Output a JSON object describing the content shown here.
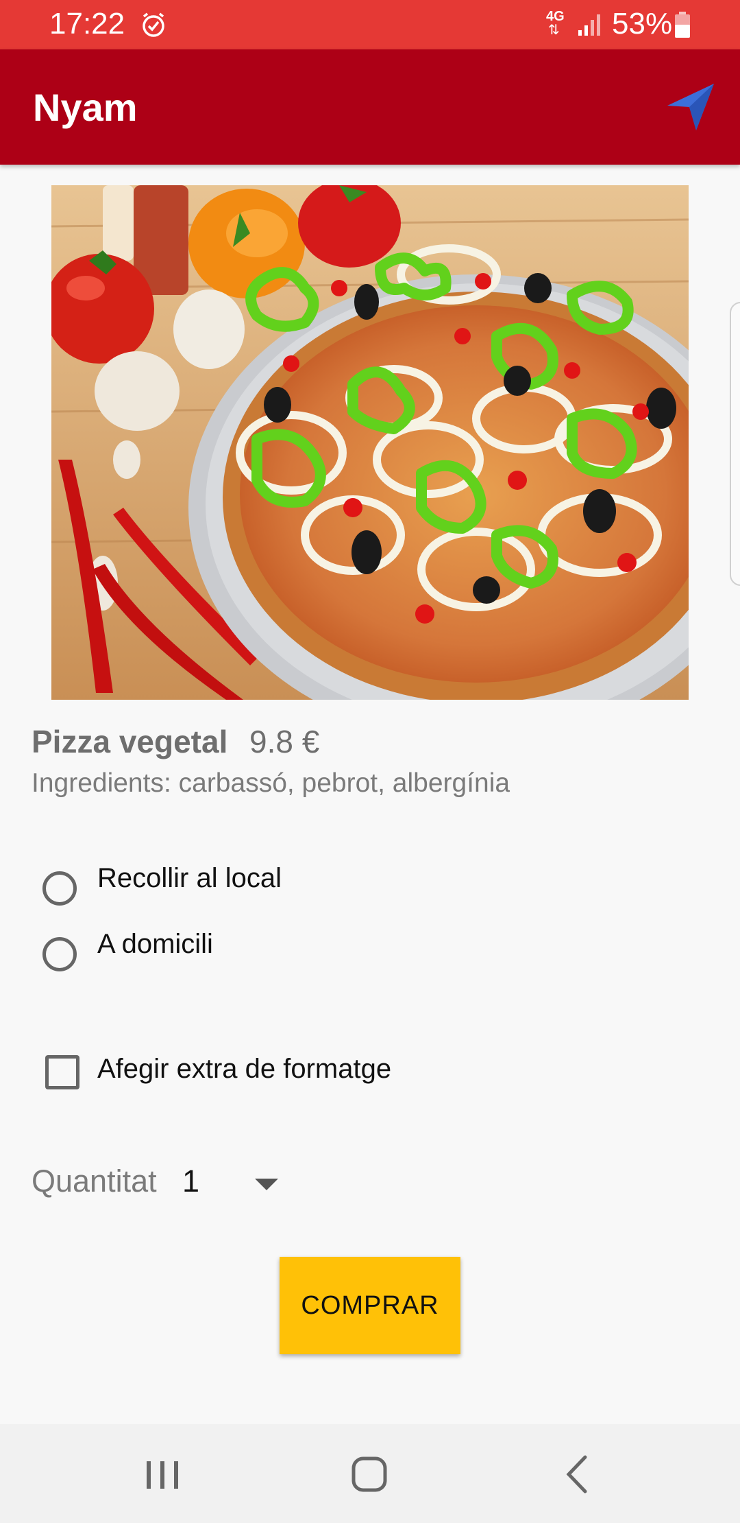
{
  "status_bar": {
    "time": "17:22",
    "network_label": "4G",
    "network_arrows": "⇅",
    "battery": "53%",
    "icons": [
      "alarm-icon",
      "signal-icon",
      "battery-icon"
    ]
  },
  "app_bar": {
    "title": "Nyam",
    "action_icon": "navigation-icon"
  },
  "product": {
    "image": "pizza-image",
    "name": "Pizza vegetal",
    "price": "9.8 €",
    "ingredients": "Ingredients: carbassó, pebrot, albergínia"
  },
  "delivery_options": [
    {
      "label": "Recollir al local",
      "selected": false
    },
    {
      "label": "A domicili",
      "selected": false
    }
  ],
  "extra_cheese": {
    "label": "Afegir extra de formatge",
    "checked": false
  },
  "quantity": {
    "label": "Quantitat",
    "value": "1"
  },
  "buy_button": {
    "label": "COMPRAR"
  },
  "colors": {
    "status_bar": "#e53935",
    "app_bar": "#ad0016",
    "button": "#ffc107",
    "background": "#f8f8f8"
  },
  "nav_bar": {
    "icons": [
      "recent-apps-icon",
      "home-icon",
      "back-icon"
    ]
  }
}
